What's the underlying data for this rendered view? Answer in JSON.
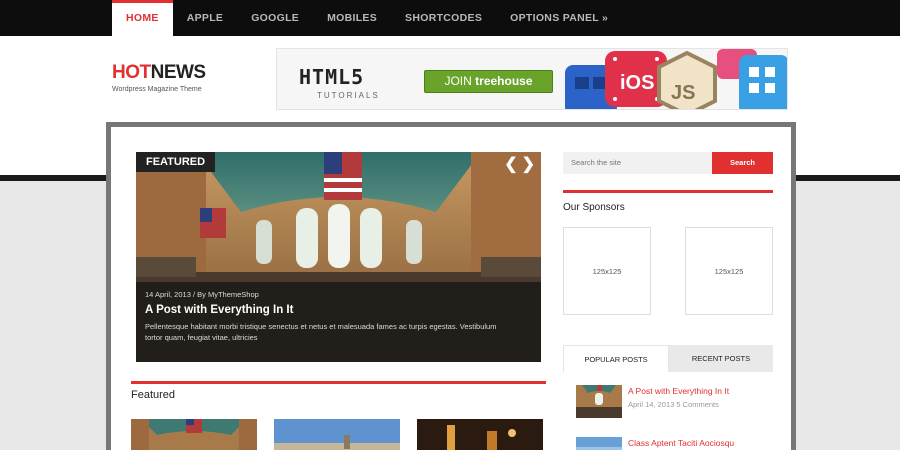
{
  "nav": {
    "items": [
      {
        "label": "HOME",
        "active": true
      },
      {
        "label": "APPLE",
        "active": false
      },
      {
        "label": "GOOGLE",
        "active": false
      },
      {
        "label": "MOBILES",
        "active": false
      },
      {
        "label": "SHORTCODES",
        "active": false
      },
      {
        "label": "OPTIONS PANEL »",
        "active": false
      }
    ]
  },
  "logo": {
    "hot": "HOT",
    "news": "NEWS",
    "tagline": "Wordpress Magazine Theme"
  },
  "banner": {
    "html5": "HTML5",
    "tutorials": "TUTORIALS",
    "join": "JOIN",
    "brand": "treehouse",
    "ios": "iOS",
    "js": "JS"
  },
  "slider": {
    "tag": "FEATURED",
    "meta": "14 April, 2013 / By MyThemeShop",
    "title": "A Post with Everything In It",
    "excerpt": "Pellentesque habitant morbi tristique senectus et netus et malesuada fames ac turpis egestas. Vestibulum tortor quam, feugiat vitae, ultricies",
    "prev_glyph": "❮",
    "next_glyph": "❯"
  },
  "search": {
    "placeholder": "Search the site",
    "button": "Search"
  },
  "sponsors": {
    "title": "Our Sponsors",
    "ad1": "125x125",
    "ad2": "125x125"
  },
  "tabs": {
    "popular": "POPULAR POSTS",
    "recent": "RECENT POSTS"
  },
  "popular_posts": [
    {
      "title": "A Post with Everything In It",
      "meta": "April 14, 2013 5 Comments"
    },
    {
      "title": "Class Aptent Taciti Aociosqu",
      "meta": ""
    }
  ],
  "featured": {
    "title": "Featured"
  },
  "colors": {
    "accent": "#e03030",
    "nav_bg": "#0d0d0d",
    "treehouse": "#6aa32a"
  }
}
